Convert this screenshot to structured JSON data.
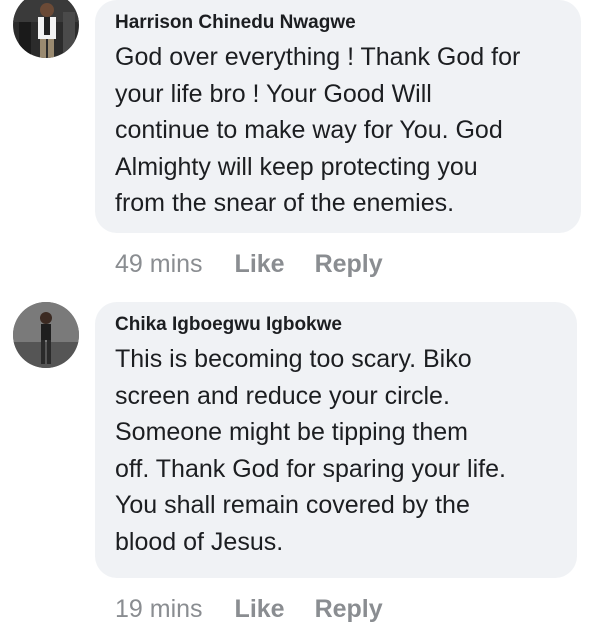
{
  "comments": [
    {
      "author": "Harrison Chinedu Nwagwe",
      "text_lines": [
        "God over everything ! Thank God for",
        "your life bro ! Your Good Will",
        "continue to make way for You. God",
        "Almighty will keep protecting you",
        "from the snear of the enemies."
      ],
      "time": "49 mins",
      "like_label": "Like",
      "reply_label": "Reply"
    },
    {
      "author": "Chika Igboegwu Igbokwe",
      "text_lines": [
        "This is becoming too scary. Biko",
        "screen and reduce your circle.",
        "Someone might be tipping them",
        "off. Thank God for sparing your life.",
        "You shall remain covered by the",
        "blood of Jesus."
      ],
      "time": "19 mins",
      "like_label": "Like",
      "reply_label": "Reply"
    }
  ]
}
